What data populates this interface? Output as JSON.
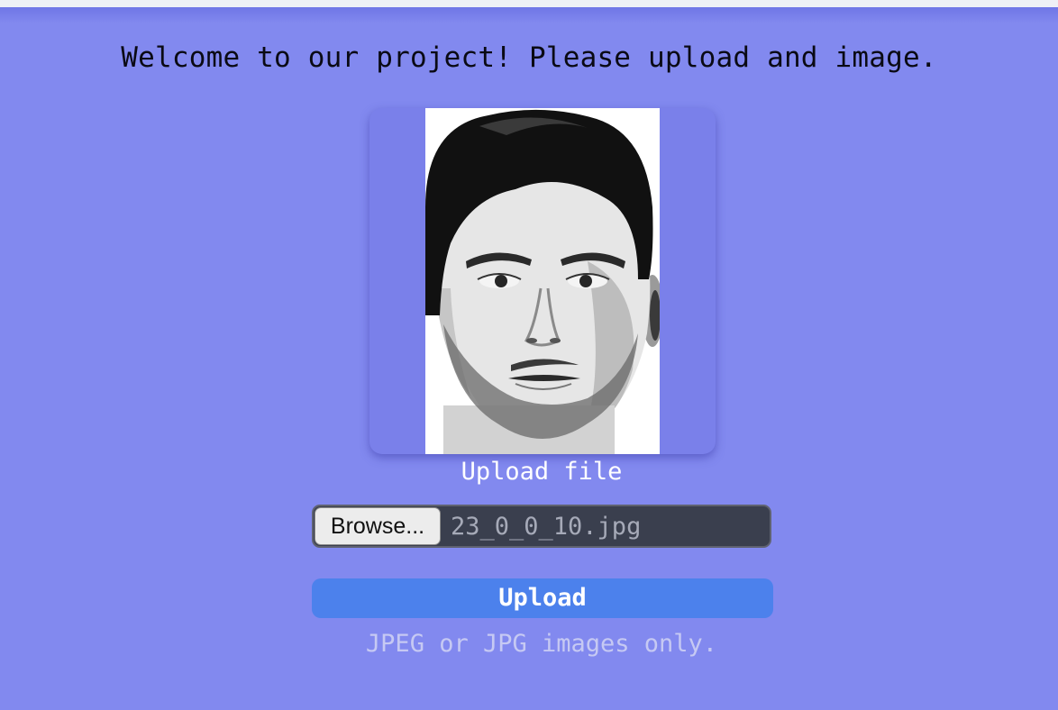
{
  "header": {
    "welcome_text": "Welcome to our project! Please upload and image."
  },
  "preview": {
    "image_kind": "face-photo",
    "alt": ""
  },
  "upload": {
    "label": "Upload file",
    "browse_label": "Browse...",
    "file_name": "23_0_0_10.jpg",
    "submit_label": "Upload",
    "hint": "JPEG or JPG images only."
  },
  "colors": {
    "background": "#8289ef",
    "upload_button": "#4c81ec",
    "file_input_bg": "#3a3f4e",
    "hint_text": "#c6c9f3"
  }
}
